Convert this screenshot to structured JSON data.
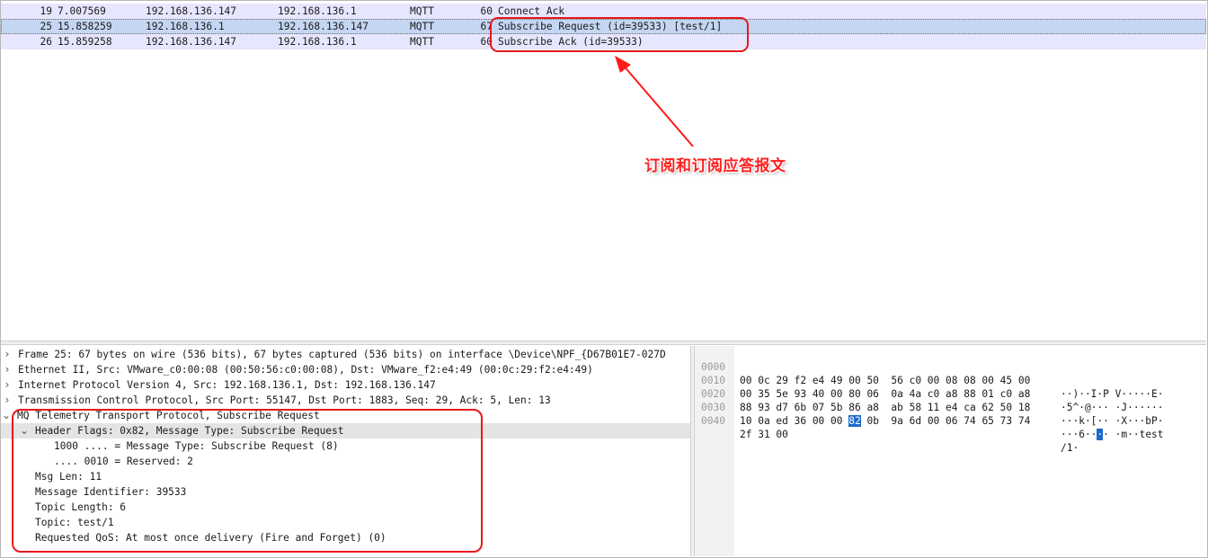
{
  "packet_list": [
    {
      "no": "19",
      "time": "7.007569",
      "src": "192.168.136.147",
      "dst": "192.168.136.1",
      "proto": "MQTT",
      "len": "60",
      "info": "Connect Ack"
    },
    {
      "no": "25",
      "time": "15.858259",
      "src": "192.168.136.1",
      "dst": "192.168.136.147",
      "proto": "MQTT",
      "len": "67",
      "info": "Subscribe Request (id=39533) [test/1]"
    },
    {
      "no": "26",
      "time": "15.859258",
      "src": "192.168.136.147",
      "dst": "192.168.136.1",
      "proto": "MQTT",
      "len": "60",
      "info": "Subscribe Ack (id=39533)"
    }
  ],
  "annotation": "订阅和订阅应答报文",
  "highlight_color": "#e8181b",
  "selected_row_color": "#c4d6f2",
  "mqtt_row_color": "#e7e6ff",
  "details": [
    {
      "twisty": "chevron-right-icon",
      "text": "Frame 25: 67 bytes on wire (536 bits), 67 bytes captured (536 bits) on interface \\Device\\NPF_{D67B01E7-027D"
    },
    {
      "twisty": "chevron-right-icon",
      "text": "Ethernet II, Src: VMware_c0:00:08 (00:50:56:c0:00:08), Dst: VMware_f2:e4:49 (00:0c:29:f2:e4:49)"
    },
    {
      "twisty": "chevron-right-icon",
      "text": "Internet Protocol Version 4, Src: 192.168.136.1, Dst: 192.168.136.147"
    },
    {
      "twisty": "chevron-right-icon",
      "text": "Transmission Control Protocol, Src Port: 55147, Dst Port: 1883, Seq: 29, Ack: 5, Len: 13"
    },
    {
      "twisty": "chevron-down-icon",
      "text": "MQ Telemetry Transport Protocol, Subscribe Request"
    },
    {
      "twisty": "chevron-down-icon",
      "text": "Header Flags: 0x82, Message Type: Subscribe Request"
    },
    {
      "twisty": "",
      "text": "1000 .... = Message Type: Subscribe Request (8)"
    },
    {
      "twisty": "",
      "text": ".... 0010 = Reserved: 2"
    },
    {
      "twisty": "",
      "text": "Msg Len: 11"
    },
    {
      "twisty": "",
      "text": "Message Identifier: 39533"
    },
    {
      "twisty": "",
      "text": "Topic Length: 6"
    },
    {
      "twisty": "",
      "text": "Topic: test/1"
    },
    {
      "twisty": "",
      "text": "Requested QoS: At most once delivery (Fire and Forget) (0)"
    }
  ],
  "bytes": [
    {
      "offset": "0000",
      "hex_a": "00 0c 29 f2 e4 49 00 50  56 c0 00 08 08 00 45 00",
      "ascii_a": "··)··I·P V·····E·"
    },
    {
      "offset": "0010",
      "hex_a": "00 35 5e 93 40 00 80 06  0a 4a c0 a8 88 01 c0 a8",
      "ascii_a": "·5^·@··· ·J······"
    },
    {
      "offset": "0020",
      "hex_a": "88 93 d7 6b 07 5b 86 a8  ab 58 11 e4 ca 62 50 18",
      "ascii_a": "···k·[·· ·X···bP·"
    },
    {
      "offset": "0030",
      "hex_a": "10 0a ed 36 00 00 ",
      "hex_sel": "82",
      "hex_b": " 0b  9a 6d 00 06 74 65 73 74",
      "ascii_a": "···6··",
      "ascii_sel": "·",
      "ascii_b": "· ·m··test"
    },
    {
      "offset": "0040",
      "hex_a": "2f 31 00",
      "ascii_a": "/1·"
    }
  ]
}
